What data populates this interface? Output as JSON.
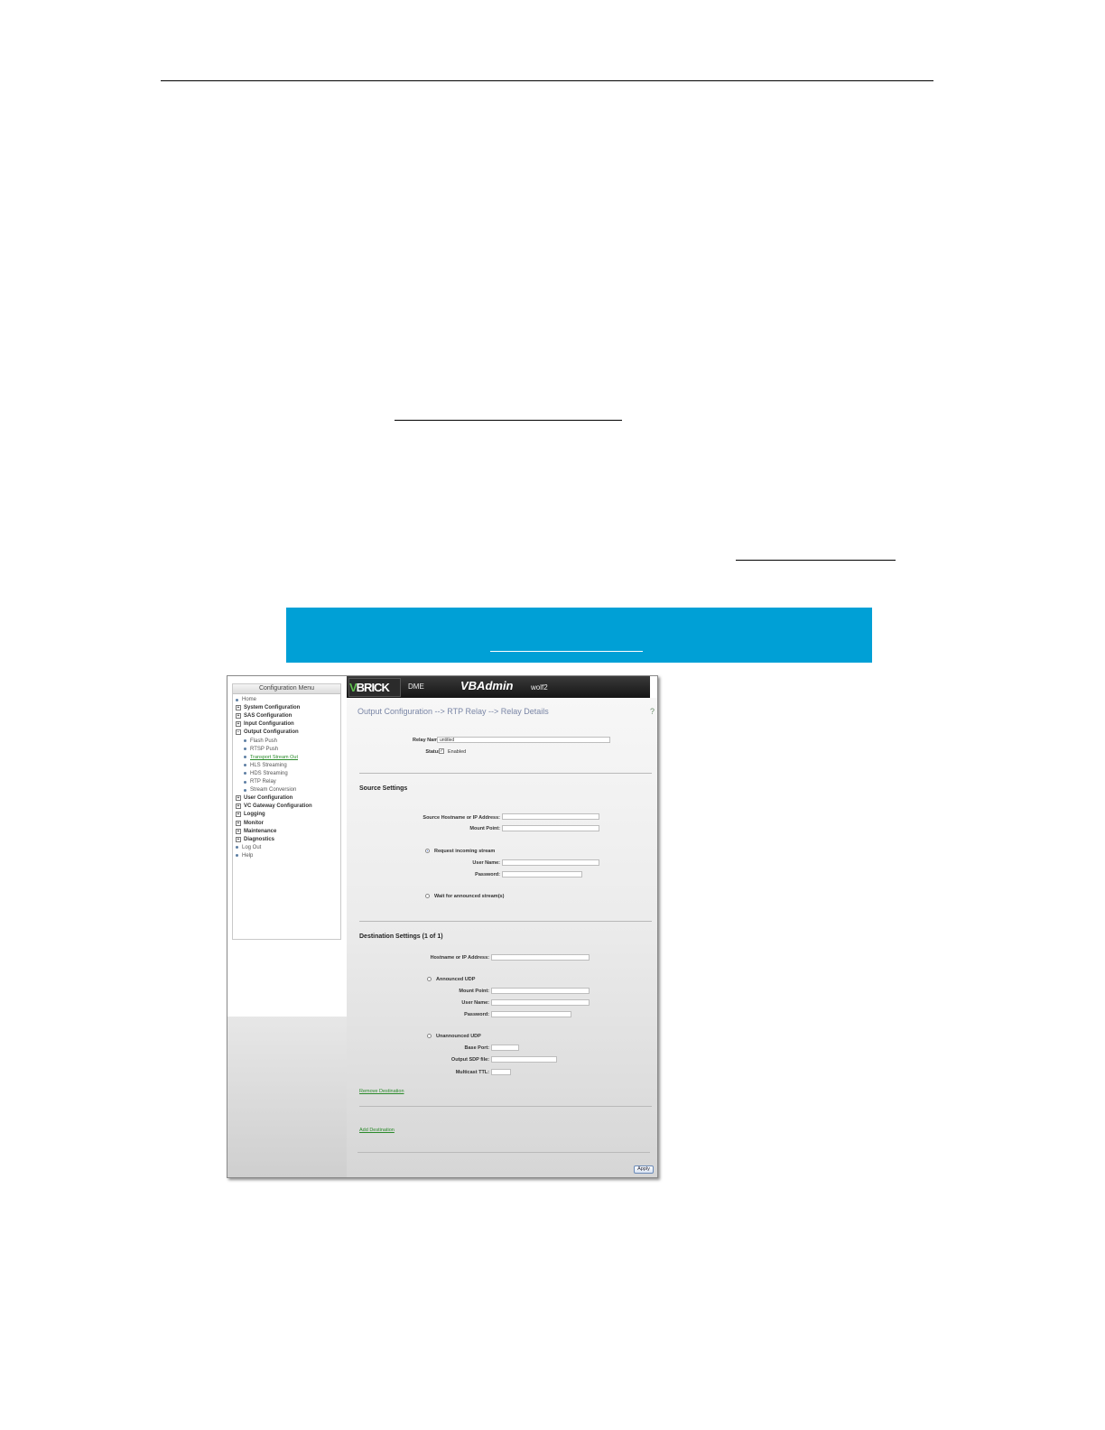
{
  "app": {
    "brand": "BRICK",
    "brand_prefix": "V",
    "product": "DME",
    "title": "VBAdmin",
    "user": "wolf2"
  },
  "menu": {
    "title": "Configuration Menu",
    "items": [
      {
        "label": "Home",
        "type": "dot"
      },
      {
        "label": "System Configuration",
        "type": "plus"
      },
      {
        "label": "SAS Configuration",
        "type": "plus"
      },
      {
        "label": "Input Configuration",
        "type": "plus"
      },
      {
        "label": "Output Configuration",
        "type": "minus"
      },
      {
        "label": "Flash Push",
        "type": "sub"
      },
      {
        "label": "RTSP Push",
        "type": "sub"
      },
      {
        "label": "Transport Stream Out",
        "type": "sub-link"
      },
      {
        "label": "HLS Streaming",
        "type": "sub"
      },
      {
        "label": "HDS Streaming",
        "type": "sub"
      },
      {
        "label": "RTP Relay",
        "type": "sub"
      },
      {
        "label": "Stream Conversion",
        "type": "sub"
      },
      {
        "label": "User Configuration",
        "type": "plus"
      },
      {
        "label": "VC Gateway Configuration",
        "type": "plus"
      },
      {
        "label": "Logging",
        "type": "plus"
      },
      {
        "label": "Monitor",
        "type": "plus"
      },
      {
        "label": "Maintenance",
        "type": "plus"
      },
      {
        "label": "Diagnostics",
        "type": "plus"
      },
      {
        "label": "Log Out",
        "type": "dot"
      },
      {
        "label": "Help",
        "type": "dot"
      }
    ]
  },
  "breadcrumb": "Output Configuration --> RTP Relay --> Relay Details",
  "breadcrumb_edge": "?",
  "relay": {
    "name_label": "Relay Name:",
    "name_value": "untitled",
    "status_label": "Status:",
    "enabled_label": "Enabled",
    "enabled_mark": "✓"
  },
  "source": {
    "heading": "Source Settings",
    "host_label": "Source Hostname or IP Address:",
    "host_value": "",
    "mount_label": "Mount Point:",
    "mount_value": "",
    "request_label": "Request incoming stream",
    "user_label": "User Name:",
    "user_value": "",
    "password_label": "Password:",
    "password_value": "",
    "wait_label": "Wait for announced stream(s)"
  },
  "destination": {
    "heading": "Destination Settings (1 of 1)",
    "host_label": "Hostname or IP Address:",
    "host_value": "",
    "announced_label": "Announced UDP",
    "mount_label": "Mount Point:",
    "mount_value": "",
    "user_label": "User Name:",
    "user_value": "",
    "password_label": "Password:",
    "password_value": "",
    "unannounced_label": "Unannounced UDP",
    "base_port_label": "Base Port:",
    "base_port_value": "",
    "sdp_label": "Output SDP file:",
    "sdp_value": "",
    "ttl_label": "Multicast TTL:",
    "ttl_value": "",
    "remove_label": "Remove Destination"
  },
  "add_destination_label": "Add Destination",
  "apply_label": "Apply"
}
